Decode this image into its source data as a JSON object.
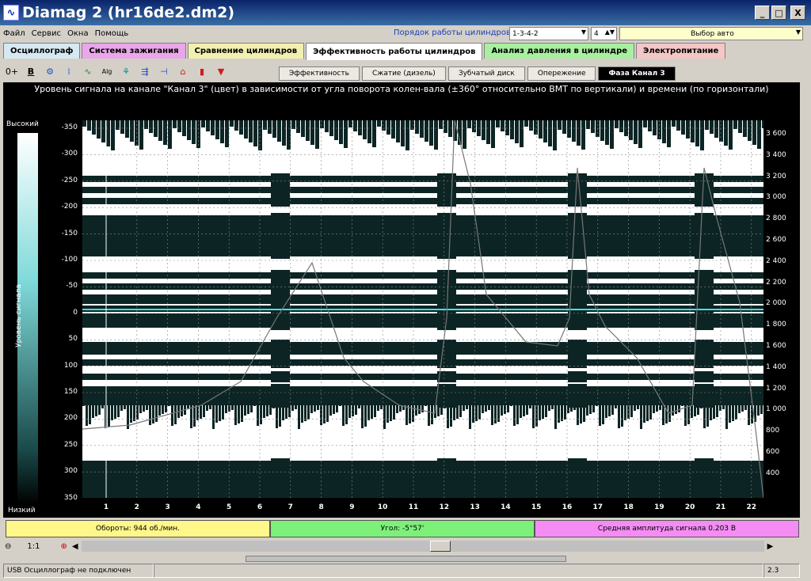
{
  "window": {
    "title": "Diamag 2 (hr16de2.dm2)",
    "min": "_",
    "max": "□",
    "close": "X"
  },
  "menu": [
    "Файл",
    "Сервис",
    "Окна",
    "Помощь"
  ],
  "order": {
    "label": "Порядок работы цилиндров",
    "value": "1-3-4-2",
    "count": "4",
    "car": "Выбор авто"
  },
  "tabs_main": [
    {
      "label": "Осциллограф",
      "color": "#d6e8f2"
    },
    {
      "label": "Система зажигания",
      "color": "#e9a6e9"
    },
    {
      "label": "Сравнение цилиндров",
      "color": "#f2f0b0"
    },
    {
      "label": "Эффективность работы цилиндров",
      "color": "#ffffff"
    },
    {
      "label": "Анализ давления в цилиндре",
      "color": "#a8efa0"
    },
    {
      "label": "Электропитание",
      "color": "#f4c6c6"
    }
  ],
  "toolbar": {
    "icons": [
      "zero-shift-icon",
      "bold-b-icon",
      "rpm-icon",
      "scale-icon",
      "curve-icon",
      "algorithm-icon",
      "filter-icon",
      "export-icon",
      "mark-icon",
      "angle-icon",
      "bar-icon",
      "funnel-icon"
    ],
    "glyphs": [
      "0+",
      "B",
      "⚙",
      "⁞",
      "∿",
      "Alg",
      "⚘",
      "⇶",
      "⊣",
      "⌂",
      "▮",
      "▼"
    ]
  },
  "tabs_sub": [
    "Эффективность",
    "Сжатие (дизель)",
    "Зубчатый диск",
    "Опережение",
    "Фаза Канал 3"
  ],
  "plot": {
    "caption": "Уровень сигнала на канале \"Канал 3\" (цвет) в зависимости от угла поворота колен-вала (±360° относительно ВМТ по вертикали) и времени (по горизонтали)",
    "legend_high": "Высокий",
    "legend_low": "Низкий",
    "legend_label": "Уровень сигнала",
    "y_left": [
      "-350",
      "-300",
      "-250",
      "-200",
      "-150",
      "-100",
      "-50",
      "0",
      "50",
      "100",
      "150",
      "200",
      "250",
      "300",
      "350"
    ],
    "y_right": [
      "3 600",
      "3 400",
      "3 200",
      "3 000",
      "2 800",
      "2 600",
      "2 400",
      "2 200",
      "2 000",
      "1 800",
      "1 600",
      "1 400",
      "1 200",
      "1 000",
      "800",
      "600",
      "400"
    ],
    "x": [
      "1",
      "2",
      "3",
      "4",
      "5",
      "6",
      "7",
      "8",
      "9",
      "10",
      "11",
      "12",
      "13",
      "14",
      "15",
      "16",
      "17",
      "18",
      "19",
      "20",
      "21",
      "22"
    ]
  },
  "status": {
    "rpm": "Обороты: 944 об./мин.",
    "angle": "Угол: -5°57'",
    "amp": "Средняя амплитуда сигнала 0.203 В"
  },
  "zoom": "1:1",
  "statusbar": {
    "usb": "USB Осциллограф не подключен",
    "version": "2.3"
  }
}
